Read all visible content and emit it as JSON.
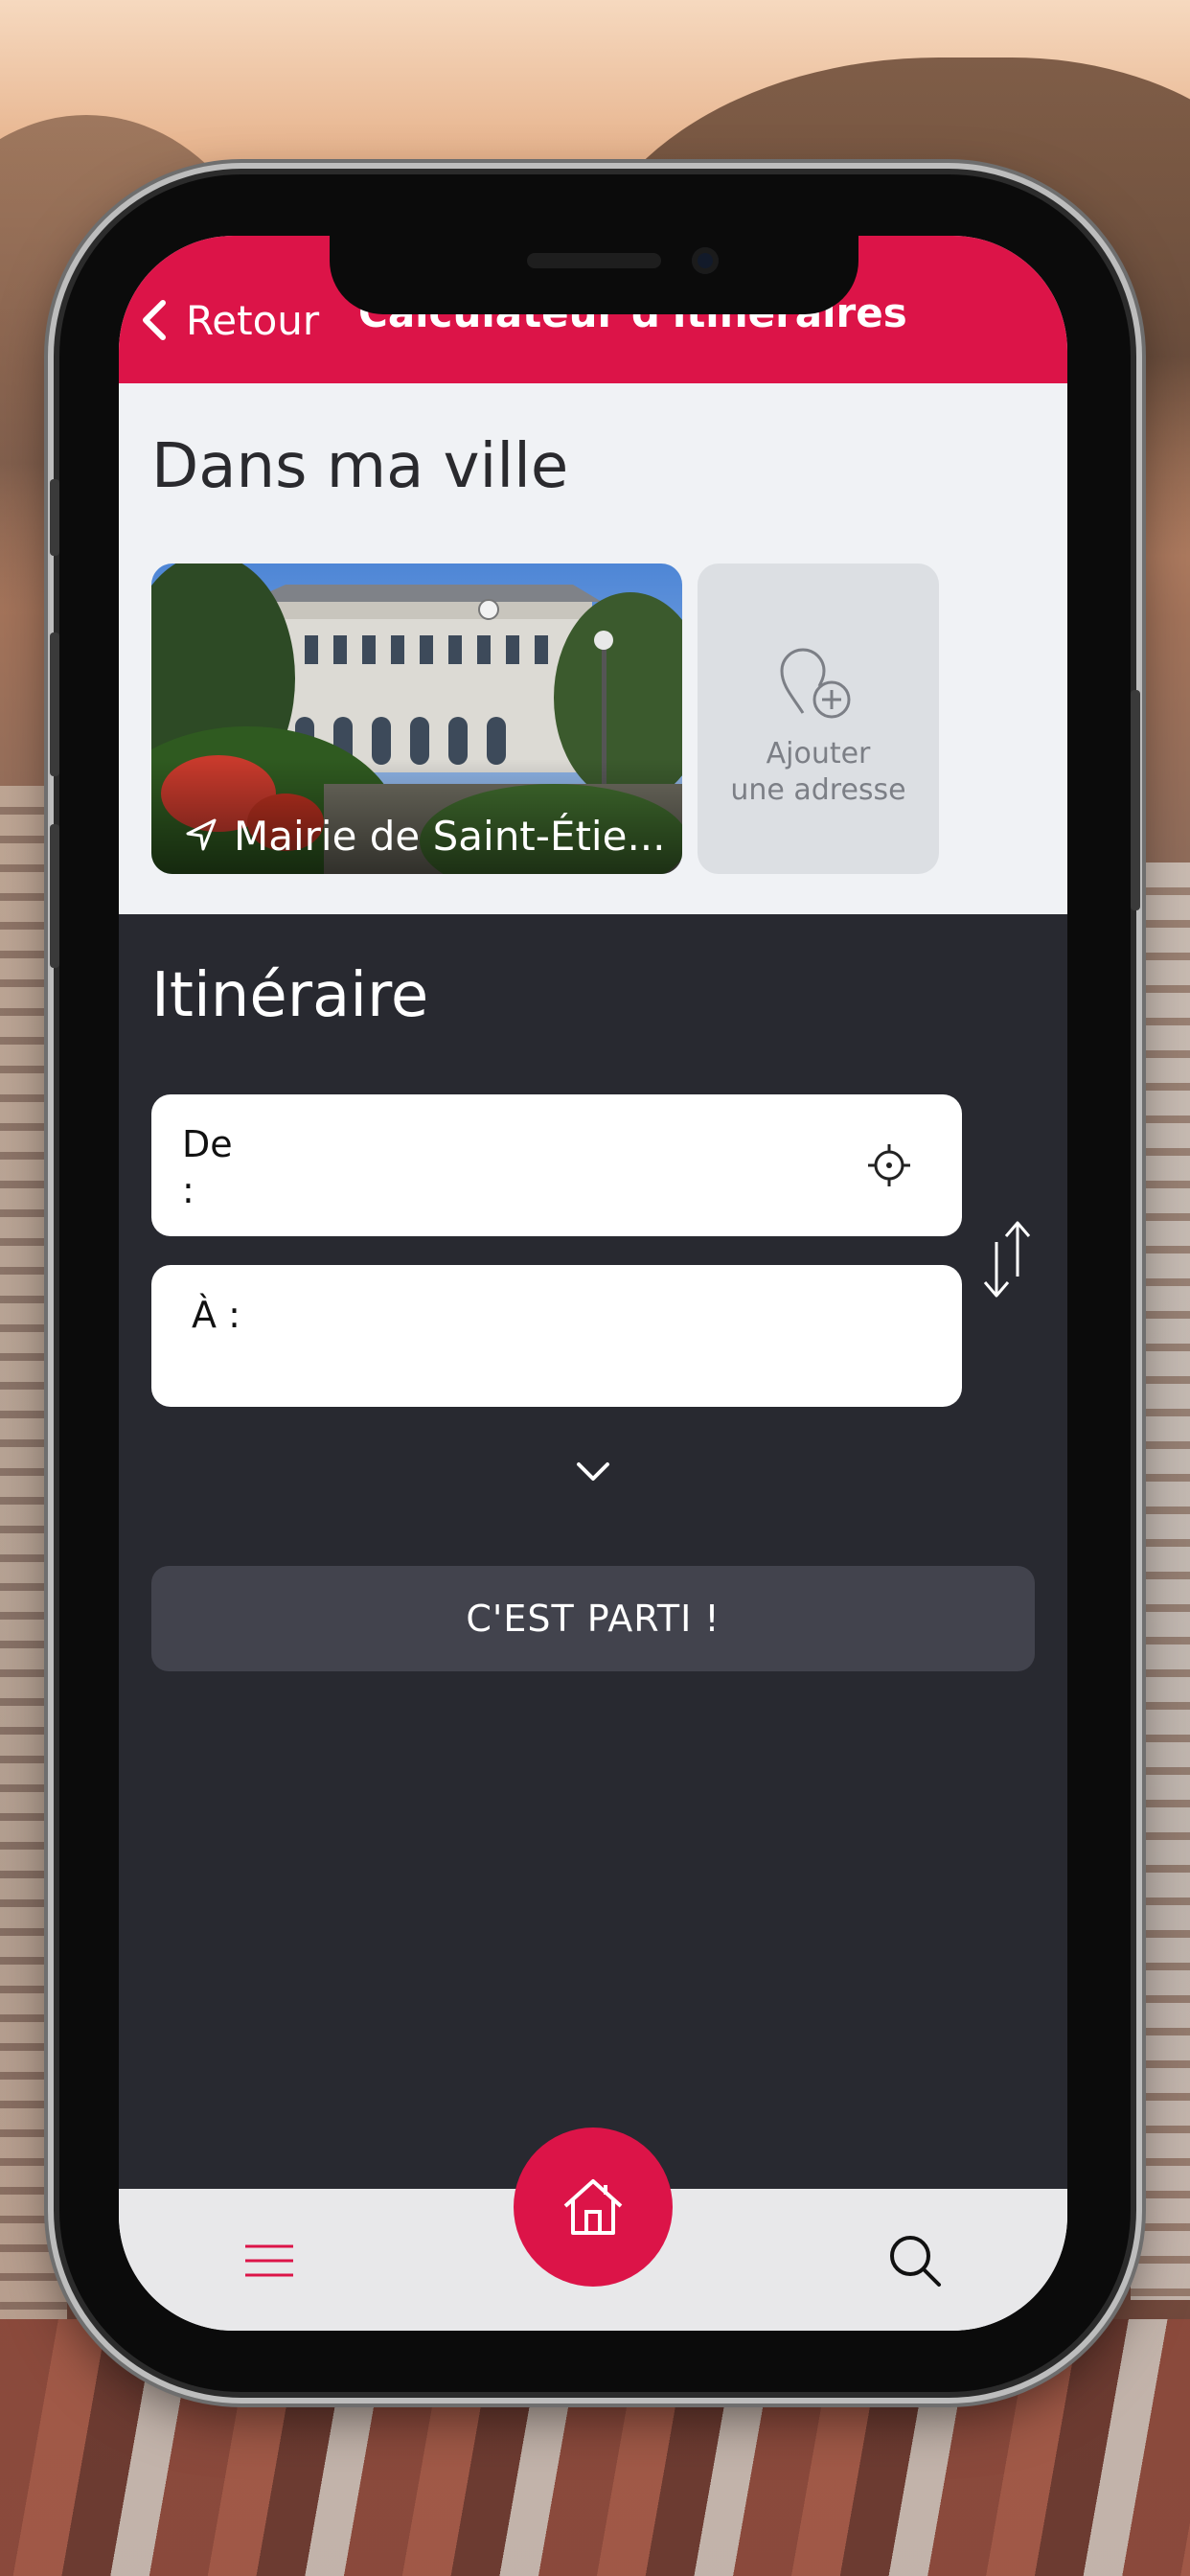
{
  "header": {
    "back_label": "Retour",
    "title": "Calculateur d'itinéraires"
  },
  "city": {
    "title": "Dans ma ville",
    "cards": [
      {
        "label": "Mairie de Saint-Étie..."
      }
    ],
    "add_card": {
      "label_line1": "Ajouter",
      "label_line2": "une adresse"
    }
  },
  "itinerary": {
    "title": "Itinéraire",
    "from_label": "De :",
    "to_label": "À :",
    "submit_label": "C'EST PARTI !"
  },
  "icons": {
    "back": "chevron-left-icon",
    "navigation": "navigation-arrow-icon",
    "add_location": "map-pin-plus-icon",
    "locate": "crosshair-icon",
    "swap": "swap-vertical-icon",
    "expand": "chevron-down-icon",
    "menu": "hamburger-menu-icon",
    "home": "home-icon",
    "search": "search-icon"
  },
  "colors": {
    "accent": "#dc1448",
    "dark_panel": "#282930",
    "button_bg": "#42434d",
    "light_bg": "#f0f2f5"
  }
}
